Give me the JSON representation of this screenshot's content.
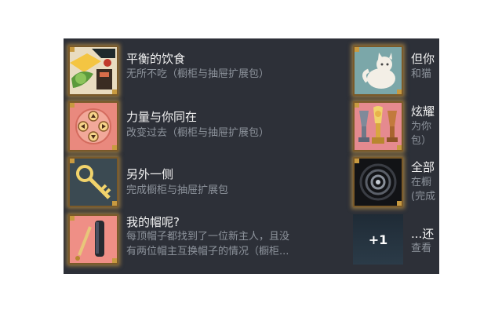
{
  "achievements_left": [
    {
      "title": "平衡的饮食",
      "desc": "无所不吃（橱柜与抽屉扩展包）",
      "icon": "food-tray-icon"
    },
    {
      "title": "力量与你同在",
      "desc": "改变过去（橱柜与抽屉扩展包）",
      "icon": "dpad-controller-icon"
    },
    {
      "title": "另外一侧",
      "desc": "完成橱柜与抽屉扩展包",
      "icon": "golden-key-icon"
    },
    {
      "title": "我的帽呢?",
      "desc_lines": [
        "每顶帽子都找到了一位新主人，且没",
        "有两位帽主互换帽子的情况（橱柜..."
      ],
      "icon": "brush-stick-icon"
    }
  ],
  "achievements_right": [
    {
      "title": "但你",
      "desc": "和猫",
      "icon": "white-cat-icon"
    },
    {
      "title": "炫耀",
      "desc_lines": [
        "为你",
        "包）"
      ],
      "icon": "trophies-icon"
    },
    {
      "title": "全部",
      "desc_lines": [
        "在橱",
        "(完成"
      ],
      "icon": "vortex-icon"
    },
    {
      "title": "...还",
      "desc": "查看",
      "icon": "more-achievements-icon"
    }
  ],
  "more_badge": "+1"
}
